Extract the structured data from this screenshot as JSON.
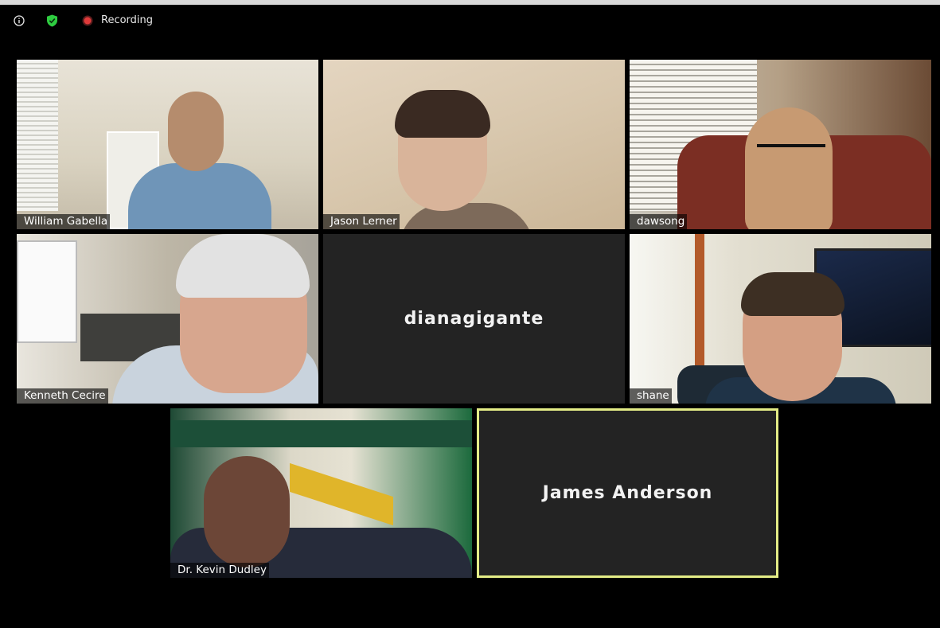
{
  "toolbar": {
    "info_icon": "info-icon",
    "security_icon": "shield-check-icon",
    "security_color": "#2ecc40",
    "recording_icon": "record-dot-icon",
    "recording_color": "#e03a3a",
    "recording_label": "Recording"
  },
  "participants": [
    {
      "name": "William Gabella",
      "video": true
    },
    {
      "name": "Jason Lerner",
      "video": true
    },
    {
      "name": "dawsong",
      "video": true
    },
    {
      "name": "Kenneth Cecire",
      "video": true
    },
    {
      "name": "dianagigante",
      "video": false
    },
    {
      "name": "shane",
      "video": true
    },
    {
      "name": "Dr. Kevin Dudley",
      "video": true
    },
    {
      "name": "James Anderson",
      "video": false,
      "active_speaker": true
    }
  ],
  "colors": {
    "background": "#000000",
    "tile_off": "#232323",
    "active_speaker_border": "#e3ec86"
  }
}
